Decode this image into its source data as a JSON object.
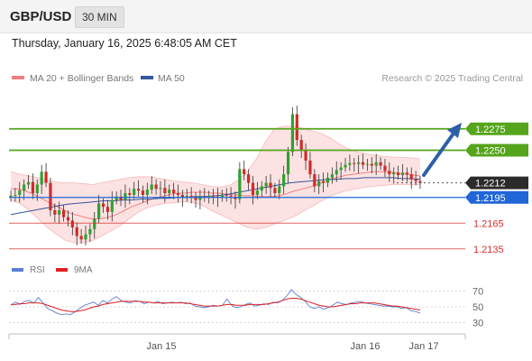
{
  "header": {
    "symbol": "GBP/USD",
    "timeframe": "30 MIN",
    "datetime": "Thursday, January 16, 2025 6:48:05 AM CET"
  },
  "legend": {
    "ma20_label": "MA 20 + Bollinger Bands",
    "ma50_label": "MA 50",
    "credit": "Research © 2025 Trading Central",
    "ma20_color": "#f08080",
    "ma50_color": "#36579a"
  },
  "rsi_legend": {
    "rsi_label": "RSI",
    "ma_label": "9MA",
    "rsi_color": "#5b7fd6",
    "ma_color": "#e02020"
  },
  "chart_data": [
    {
      "type": "candlestick",
      "ylim": [
        1.212,
        1.232
      ],
      "price_tags": [
        {
          "value": 1.2275,
          "label": "1.2275",
          "kind": "resistance",
          "color": "#55a51c"
        },
        {
          "value": 1.225,
          "label": "1.2250",
          "kind": "resistance",
          "color": "#55a51c"
        },
        {
          "value": 1.2212,
          "label": "1.2212",
          "kind": "last-price",
          "color": "#2b2b2b"
        },
        {
          "value": 1.2195,
          "label": "1.2195",
          "kind": "pivot",
          "color": "#2166d6"
        },
        {
          "value": 1.2165,
          "label": "1.2165",
          "kind": "support",
          "color": "#d83030"
        },
        {
          "value": 1.2135,
          "label": "1.2135",
          "kind": "support",
          "color": "#d83030"
        }
      ],
      "close": [
        1.2197,
        1.2198,
        1.2203,
        1.221,
        1.2213,
        1.22,
        1.221,
        1.2225,
        1.2212,
        1.218,
        1.2175,
        1.218,
        1.2172,
        1.2168,
        1.216,
        1.215,
        1.2146,
        1.2152,
        1.2158,
        1.217,
        1.2188,
        1.2184,
        1.2178,
        1.2192,
        1.2196,
        1.2192,
        1.22,
        1.2198,
        1.2205,
        1.2203,
        1.2198,
        1.2204,
        1.221,
        1.2205,
        1.2206,
        1.22,
        1.2204,
        1.22,
        1.2198,
        1.2195,
        1.2197,
        1.2195,
        1.2192,
        1.2196,
        1.2195,
        1.2197,
        1.2196,
        1.2195,
        1.2198,
        1.2197,
        1.2196,
        1.2193,
        1.2228,
        1.2222,
        1.2212,
        1.2198,
        1.2203,
        1.2208,
        1.2212,
        1.2206,
        1.22,
        1.2208,
        1.2222,
        1.2248,
        1.2292,
        1.2262,
        1.225,
        1.2238,
        1.2222,
        1.2208,
        1.2214,
        1.2212,
        1.2218,
        1.2222,
        1.2227,
        1.223,
        1.2233,
        1.2235,
        1.2234,
        1.2236,
        1.2233,
        1.2234,
        1.2232,
        1.2236,
        1.2232,
        1.2226,
        1.2222,
        1.2224,
        1.2221,
        1.2224,
        1.2222,
        1.2216,
        1.2214,
        1.2212
      ],
      "open": [
        1.2195,
        1.2197,
        1.2198,
        1.2203,
        1.221,
        1.2213,
        1.22,
        1.221,
        1.2225,
        1.2212,
        1.218,
        1.2175,
        1.218,
        1.2172,
        1.2168,
        1.216,
        1.215,
        1.2146,
        1.2152,
        1.2158,
        1.217,
        1.2188,
        1.2184,
        1.2178,
        1.2192,
        1.2196,
        1.2192,
        1.22,
        1.2198,
        1.2205,
        1.2203,
        1.2198,
        1.2204,
        1.221,
        1.2205,
        1.2206,
        1.22,
        1.2204,
        1.22,
        1.2198,
        1.2195,
        1.2197,
        1.2195,
        1.2192,
        1.2196,
        1.2195,
        1.2197,
        1.2196,
        1.2195,
        1.2198,
        1.2197,
        1.2196,
        1.2193,
        1.2228,
        1.2222,
        1.2212,
        1.2198,
        1.2203,
        1.2208,
        1.2212,
        1.2206,
        1.22,
        1.2208,
        1.2222,
        1.2248,
        1.2292,
        1.2262,
        1.225,
        1.2238,
        1.2222,
        1.2208,
        1.2214,
        1.2212,
        1.2218,
        1.2222,
        1.2227,
        1.223,
        1.2233,
        1.2235,
        1.2234,
        1.2236,
        1.2233,
        1.2234,
        1.2232,
        1.2236,
        1.2232,
        1.2226,
        1.2222,
        1.2224,
        1.2221,
        1.2224,
        1.2222,
        1.2216,
        1.2214
      ],
      "ma20": [
        1.2205,
        1.2205,
        1.2203,
        1.22,
        1.2196,
        1.2192,
        1.2188,
        1.2184,
        1.218,
        1.2176,
        1.2174,
        1.2172,
        1.217,
        1.217,
        1.2171,
        1.2173,
        1.2176,
        1.218,
        1.2184,
        1.2187,
        1.219,
        1.2193,
        1.2195,
        1.2197,
        1.2199,
        1.22,
        1.22,
        1.2201,
        1.2201,
        1.2201,
        1.22,
        1.22,
        1.2199,
        1.2198,
        1.2198,
        1.2197,
        1.2197,
        1.2196,
        1.2196,
        1.2196,
        1.2197,
        1.2199,
        1.2202,
        1.2204,
        1.2206,
        1.2208,
        1.2211,
        1.2214,
        1.2217,
        1.2219,
        1.2221,
        1.2222,
        1.2223,
        1.2224,
        1.2225,
        1.2225,
        1.2225,
        1.2224,
        1.2223,
        1.2222,
        1.2221,
        1.222
      ],
      "ma50": [
        1.2175,
        1.2177,
        1.2179,
        1.2181,
        1.2183,
        1.2185,
        1.2187,
        1.2188,
        1.2189,
        1.219,
        1.2191,
        1.2191,
        1.2192,
        1.2192,
        1.2193,
        1.2193,
        1.2194,
        1.2194,
        1.2195,
        1.2195,
        1.2196,
        1.2196,
        1.2197,
        1.2198,
        1.22,
        1.2202,
        1.2204,
        1.2206,
        1.2208,
        1.221,
        1.2212,
        1.2213,
        1.2214,
        1.2215,
        1.2216,
        1.2216,
        1.2217,
        1.2217,
        1.2218,
        1.2218,
        1.2218,
        1.2218,
        1.2217,
        1.2217,
        1.2216
      ],
      "bb_upper": [
        1.2225,
        1.2222,
        1.222,
        1.2218,
        1.2215,
        1.2213,
        1.2212,
        1.2212,
        1.2211,
        1.221,
        1.2212,
        1.2214,
        1.2216,
        1.2218,
        1.2219,
        1.2219,
        1.2218,
        1.2216,
        1.2214,
        1.2213,
        1.2212,
        1.221,
        1.2208,
        1.2207,
        1.2209,
        1.2215,
        1.2225,
        1.224,
        1.226,
        1.2275,
        1.2278,
        1.2278,
        1.2276,
        1.2273,
        1.227,
        1.2265,
        1.2258,
        1.2252,
        1.2248,
        1.2246,
        1.2244,
        1.2243,
        1.2242,
        1.2242,
        1.2241,
        1.224
      ],
      "bb_lower": [
        1.2192,
        1.2188,
        1.218,
        1.217,
        1.216,
        1.2152,
        1.2145,
        1.2142,
        1.2142,
        1.2145,
        1.215,
        1.2156,
        1.2162,
        1.217,
        1.2178,
        1.2183,
        1.2186,
        1.2188,
        1.2189,
        1.219,
        1.2189,
        1.2186,
        1.218,
        1.2175,
        1.217,
        1.2165,
        1.216,
        1.2158,
        1.216,
        1.2164,
        1.2168,
        1.2172,
        1.2178,
        1.2184,
        1.219,
        1.2196,
        1.22,
        1.2203,
        1.2205,
        1.2207,
        1.2208,
        1.2209,
        1.221,
        1.221,
        1.221,
        1.221
      ]
    },
    {
      "type": "line",
      "ylim": [
        20,
        80
      ],
      "yticks": [
        70,
        50,
        30
      ],
      "rsi": [
        52,
        56,
        53,
        57,
        58,
        55,
        62,
        55,
        48,
        45,
        42,
        40,
        41,
        40,
        44,
        48,
        52,
        54,
        56,
        52,
        58,
        55,
        60,
        63,
        58,
        56,
        55,
        58,
        57,
        54,
        56,
        55,
        57,
        54,
        55,
        56,
        55,
        56,
        54,
        55,
        51,
        50,
        49,
        50,
        52,
        51,
        52,
        60,
        52,
        49,
        50,
        53,
        55,
        51,
        52,
        54,
        53,
        56,
        55,
        58,
        64,
        72,
        66,
        62,
        57,
        50,
        48,
        50,
        47,
        49,
        52,
        56,
        54,
        53,
        55,
        56,
        57,
        55,
        54,
        53,
        52,
        51,
        51,
        50,
        50,
        48,
        49,
        45,
        44,
        42
      ],
      "ma9": [
        53,
        53,
        54,
        54,
        55,
        55,
        55,
        54,
        52,
        50,
        48,
        46,
        45,
        44,
        44,
        45,
        46,
        48,
        50,
        51,
        53,
        54,
        55,
        56,
        57,
        57,
        57,
        57,
        57,
        56,
        56,
        55,
        55,
        55,
        55,
        55,
        55,
        55,
        55,
        54,
        53,
        52,
        51,
        51,
        51,
        51,
        52,
        53,
        53,
        52,
        52,
        52,
        53,
        53,
        53,
        53,
        54,
        55,
        56,
        58,
        60,
        61,
        61,
        60,
        58,
        56,
        54,
        52,
        51,
        50,
        50,
        51,
        52,
        53,
        54,
        54,
        55,
        55,
        55,
        55,
        54,
        53,
        52,
        51,
        51,
        50,
        49,
        48,
        47,
        46
      ]
    }
  ],
  "x_axis": {
    "labels": [
      "Jan 15",
      "Jan 16",
      "Jan 17"
    ]
  }
}
